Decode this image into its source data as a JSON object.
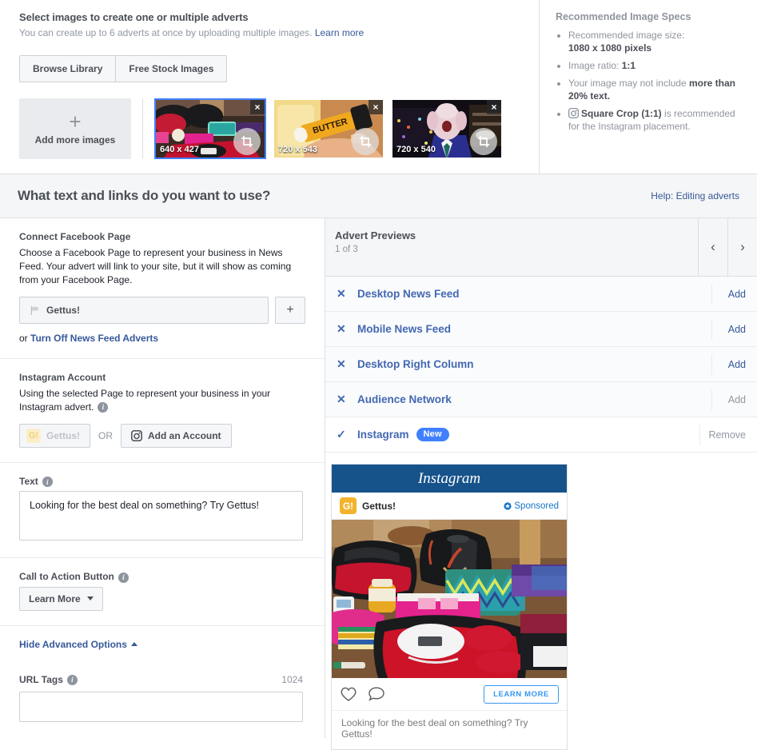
{
  "image_section": {
    "title": "Select images to create one or multiple adverts",
    "subtitle": "You can create up to 6 adverts at once by uploading multiple images.",
    "learn_more": "Learn more",
    "buttons": [
      {
        "label": "Browse Library",
        "name": "browse-library-button"
      },
      {
        "label": "Free Stock Images",
        "name": "free-stock-images-button"
      }
    ],
    "add_more": {
      "label": "Add more images",
      "plus": "+"
    },
    "thumbnails": [
      {
        "dimensions": "640 x 427",
        "selected": true,
        "close": "×"
      },
      {
        "dimensions": "720 x 543",
        "selected": false,
        "close": "×"
      },
      {
        "dimensions": "720 x 540",
        "selected": false,
        "close": "×"
      }
    ]
  },
  "specs": {
    "title": "Recommended Image Specs",
    "items": [
      {
        "text": "Recommended image size:",
        "strong": "1080 x 1080 pixels",
        "break": true
      },
      {
        "text": "Image ratio: ",
        "strong": "1:1"
      },
      {
        "text": "Your image may not include ",
        "strong": "more than 20% text."
      },
      {
        "icon": "instagram-icon",
        "strong": "Square Crop (1:1)",
        "text": " is recommended for the Instagram placement."
      }
    ]
  },
  "section2": {
    "title": "What text and links do you want to use?",
    "help_link": "Help: Editing adverts"
  },
  "form": {
    "facebook_page": {
      "label": "Connect Facebook Page",
      "description": "Choose a Facebook Page to represent your business in News Feed. Your advert will link to your site, but it will show as coming from your Facebook Page.",
      "selected_page": "Gettus!",
      "add_button": "+",
      "or_prefix": "or ",
      "turn_off_link": "Turn Off News Feed Adverts"
    },
    "instagram_account": {
      "label": "Instagram Account",
      "description": "Using the selected Page to represent your business in your Instagram advert.",
      "chip_label": "Gettus!",
      "or": "OR",
      "add_account": "Add an Account"
    },
    "text": {
      "label": "Text",
      "value": "Looking for the best deal on something? Try Gettus!",
      "placeholder": ""
    },
    "cta": {
      "label": "Call to Action Button",
      "value": "Learn More"
    },
    "advanced": {
      "toggle_label": "Hide Advanced Options",
      "url_tags_label": "URL Tags",
      "url_tags_count": "1024",
      "url_tags_value": "",
      "url_tags_placeholder": ""
    }
  },
  "preview": {
    "title": "Advert Previews",
    "counter": "1 of 3",
    "prev_arrow": "‹",
    "next_arrow": "›",
    "placements": [
      {
        "name": "Desktop News Feed",
        "icon": "✕",
        "checked": false,
        "action": "Add",
        "action_dim": false
      },
      {
        "name": "Mobile News Feed",
        "icon": "✕",
        "checked": false,
        "action": "Add",
        "action_dim": false
      },
      {
        "name": "Desktop Right Column",
        "icon": "✕",
        "checked": false,
        "action": "Add",
        "action_dim": false
      },
      {
        "name": "Audience Network",
        "icon": "✕",
        "checked": false,
        "action": "Add",
        "action_dim": true
      },
      {
        "name": "Instagram",
        "icon": "✓",
        "checked": true,
        "badge": "New",
        "action": "Remove",
        "action_dim": true
      }
    ],
    "instagram_card": {
      "header": "Instagram",
      "account_name": "Gettus!",
      "sponsored": "Sponsored",
      "cta_button": "LEARN MORE",
      "caption": "Looking for the best deal on something? Try Gettus!"
    }
  },
  "colors": {
    "link": "#365899",
    "placement_blue": "#4267b2",
    "badge_blue": "#4080ff",
    "instagram_bar": "#17538b",
    "ig_cta": "#3897f0",
    "brand_yellow": "#f3b32c"
  }
}
